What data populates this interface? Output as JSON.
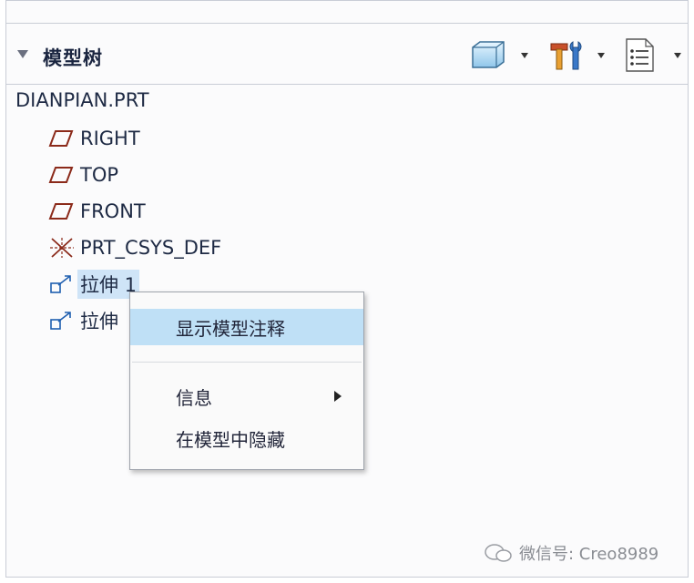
{
  "panel": {
    "title": "模型树",
    "toolbar": [
      {
        "icon": "display-style-icon"
      },
      {
        "icon": "tools-icon"
      },
      {
        "icon": "settings-list-icon"
      }
    ]
  },
  "tree": {
    "root": "DIANPIAN.PRT",
    "items": [
      {
        "label": "RIGHT",
        "icon": "datum-plane-icon"
      },
      {
        "label": "TOP",
        "icon": "datum-plane-icon"
      },
      {
        "label": "FRONT",
        "icon": "datum-plane-icon"
      },
      {
        "label": "PRT_CSYS_DEF",
        "icon": "coordinate-system-icon"
      },
      {
        "label": "拉伸 1",
        "icon": "extrude-icon",
        "selected": true
      },
      {
        "label": "拉伸",
        "icon": "extrude-icon"
      }
    ]
  },
  "context_menu": {
    "items": [
      {
        "label": "显示模型注释",
        "highlighted": true
      },
      {
        "label": "信息",
        "submenu": true
      },
      {
        "label": "在模型中隐藏"
      }
    ]
  },
  "watermark": "微信号: Creo8989",
  "colors": {
    "selection": "#cfe4f7",
    "menu_highlight": "#bfe0f6",
    "plane_icon": "#8b2a1a",
    "feature_icon": "#1f5fb0"
  }
}
